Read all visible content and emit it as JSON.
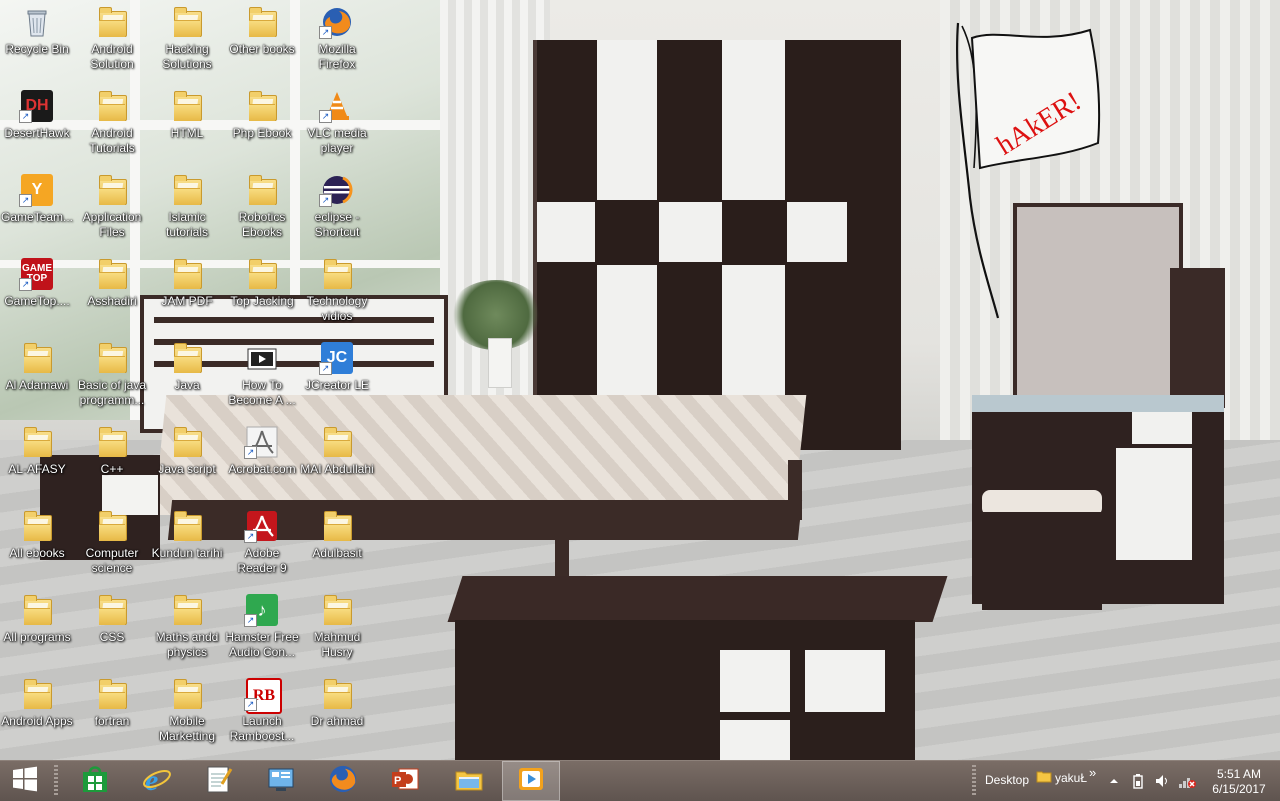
{
  "desktop": {
    "icons": [
      {
        "label": "Recycle Bin",
        "icon": "recycle-bin-icon"
      },
      {
        "label": "Android Solution",
        "icon": "folder-icon"
      },
      {
        "label": "Hacking Solutions",
        "icon": "folder-icon"
      },
      {
        "label": "Other books",
        "icon": "folder-icon"
      },
      {
        "label": "Mozilla Firefox",
        "icon": "firefox-icon"
      },
      {
        "label": "DesertHawk",
        "icon": "deserthawk-icon"
      },
      {
        "label": "Android Tutorials",
        "icon": "folder-icon"
      },
      {
        "label": "HTML",
        "icon": "folder-icon"
      },
      {
        "label": "Php Ebook",
        "icon": "folder-icon"
      },
      {
        "label": "VLC media player",
        "icon": "vlc-icon"
      },
      {
        "label": "GameTeam...",
        "icon": "gameteam-icon"
      },
      {
        "label": "Application Files",
        "icon": "folder-icon"
      },
      {
        "label": "Islamic tutorials",
        "icon": "folder-icon"
      },
      {
        "label": "Robotics Ebooks",
        "icon": "folder-icon"
      },
      {
        "label": "eclipse - Shortcut",
        "icon": "eclipse-icon"
      },
      {
        "label": "GameTop....",
        "icon": "gametop-icon"
      },
      {
        "label": "Asshadiri",
        "icon": "folder-icon"
      },
      {
        "label": "JAM PDF",
        "icon": "folder-icon"
      },
      {
        "label": "Top Jacking",
        "icon": "folder-icon"
      },
      {
        "label": "Technology vidios",
        "icon": "folder-icon"
      },
      {
        "label": "Al Adamawi",
        "icon": "folder-icon"
      },
      {
        "label": "Basic of java programm...",
        "icon": "folder-icon"
      },
      {
        "label": "Java",
        "icon": "folder-icon"
      },
      {
        "label": "How To Become A ...",
        "icon": "video-file-icon"
      },
      {
        "label": "JCreator LE",
        "icon": "jcreator-icon"
      },
      {
        "label": "AL-AFASY",
        "icon": "folder-icon"
      },
      {
        "label": "C++",
        "icon": "folder-icon"
      },
      {
        "label": "Java script",
        "icon": "folder-icon"
      },
      {
        "label": "Acrobat.com",
        "icon": "acrobat-com-icon"
      },
      {
        "label": "MAI Abdullahi",
        "icon": "folder-icon"
      },
      {
        "label": "All ebooks",
        "icon": "folder-icon"
      },
      {
        "label": "Computer science",
        "icon": "folder-icon"
      },
      {
        "label": "Kundun tarihi",
        "icon": "folder-icon"
      },
      {
        "label": "Adobe Reader 9",
        "icon": "adobe-reader-icon"
      },
      {
        "label": "Adulbasit",
        "icon": "folder-icon"
      },
      {
        "label": "All programs",
        "icon": "folder-icon"
      },
      {
        "label": "CSS",
        "icon": "folder-icon"
      },
      {
        "label": "Maths andd physics",
        "icon": "folder-icon"
      },
      {
        "label": "Hamster Free Audio Con...",
        "icon": "hamster-audio-icon"
      },
      {
        "label": "Mahmud Husry",
        "icon": "folder-icon"
      },
      {
        "label": "Android Apps",
        "icon": "folder-icon"
      },
      {
        "label": "fortran",
        "icon": "folder-icon"
      },
      {
        "label": "Mobile Marketting",
        "icon": "folder-icon"
      },
      {
        "label": "Launch Ramboost...",
        "icon": "ramboost-icon"
      },
      {
        "label": "Dr ahmad",
        "icon": "folder-icon"
      }
    ],
    "wallpaper_scribble": "hAkER!"
  },
  "taskbar": {
    "buttons": [
      {
        "name": "start-button",
        "icon": "windows-logo-icon"
      },
      {
        "name": "store-button",
        "icon": "store-icon"
      },
      {
        "name": "internet-explorer-button",
        "icon": "internet-explorer-icon"
      },
      {
        "name": "notepad-button",
        "icon": "notepad-icon"
      },
      {
        "name": "control-panel-button",
        "icon": "control-panel-icon"
      },
      {
        "name": "firefox-button",
        "icon": "firefox-icon"
      },
      {
        "name": "powerpoint-button",
        "icon": "powerpoint-icon"
      },
      {
        "name": "file-explorer-button",
        "icon": "file-explorer-icon"
      },
      {
        "name": "media-player-button",
        "icon": "media-player-icon"
      }
    ],
    "desktop_toolbar_label": "Desktop",
    "user_toolbar_label": "yakuŁ",
    "chevron": "»",
    "clock": {
      "time": "5:51 AM",
      "date": "6/15/2017"
    },
    "colors": {
      "taskbar": "#5f544f",
      "active_button": "#8b827c"
    }
  }
}
